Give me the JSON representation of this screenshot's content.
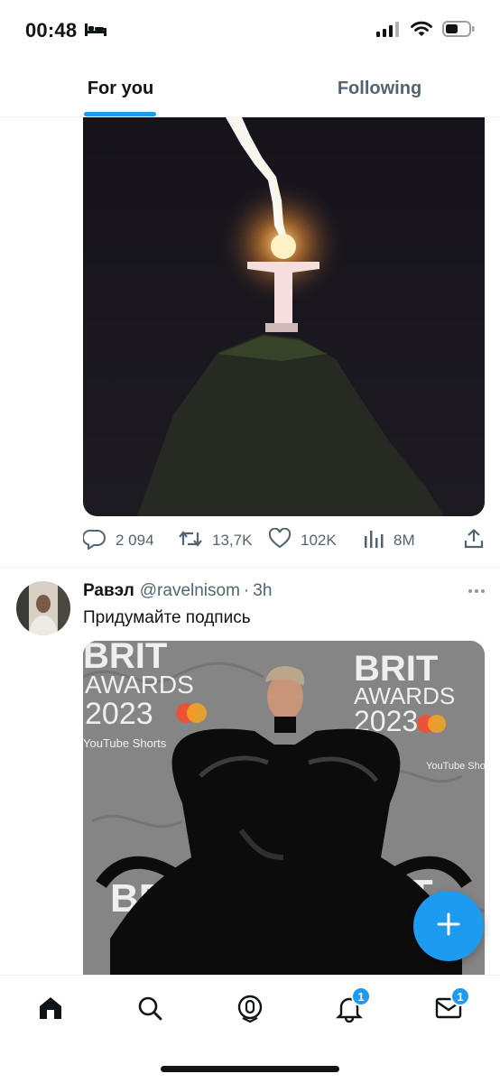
{
  "status_bar": {
    "time": "00:48",
    "sleep_icon": "bed-icon",
    "signal_icon": "cellular-signal-icon",
    "wifi_icon": "wifi-icon",
    "battery_icon": "battery-icon"
  },
  "tabs": [
    {
      "label": "For you",
      "active": true
    },
    {
      "label": "Following",
      "active": false
    }
  ],
  "tweet1": {
    "media_description_icon": "image-icon",
    "actions": {
      "replies": "2 094",
      "retweets": "13,7K",
      "likes": "102K",
      "views": "8M"
    }
  },
  "tweet2": {
    "name": "Равэл",
    "handle": "@ravelnisom",
    "separator": "·",
    "time": "3h",
    "text": "Придумайте подпись",
    "media": {
      "backdrop_line1": "BRIT",
      "backdrop_line2": "AWARDS",
      "backdrop_line3": "2023",
      "backdrop_sponsor": "YouTube Shorts"
    }
  },
  "bottom_nav": {
    "items": [
      {
        "name": "home",
        "badge": ""
      },
      {
        "name": "search",
        "badge": ""
      },
      {
        "name": "spaces",
        "badge": ""
      },
      {
        "name": "notifications",
        "badge": "1"
      },
      {
        "name": "messages",
        "badge": "1"
      }
    ]
  },
  "colors": {
    "accent": "#1d9bf0",
    "text_primary": "#0f1419",
    "text_secondary": "#536471"
  }
}
